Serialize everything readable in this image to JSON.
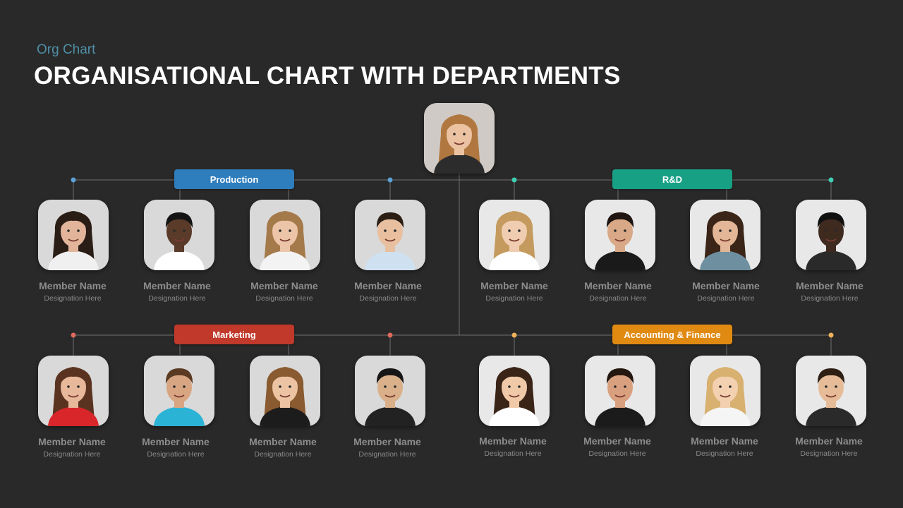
{
  "header": {
    "subtitle": "Org Chart",
    "title": "ORGANISATIONAL CHART WITH DEPARTMENTS"
  },
  "colors": {
    "background": "#292929",
    "line": "#6e6e6e",
    "production": "#2e7dbd",
    "rd": "#18a085",
    "marketing": "#c0392b",
    "accounting": "#e08a12"
  },
  "ceo": {
    "avatar": "avatar-woman-long-hair"
  },
  "departments": [
    {
      "label": "Production",
      "color": "#2e7dbd",
      "dot_color": "#5aa2d8",
      "members": [
        {
          "name": "Member Name",
          "designation": "Designation Here",
          "skin": "#e2b59a",
          "hair": "#2a1d16",
          "shirt": "#f0f0f0",
          "longhair": true
        },
        {
          "name": "Member Name",
          "designation": "Designation Here",
          "skin": "#5a3a28",
          "hair": "#141414",
          "shirt": "#ffffff",
          "longhair": false
        },
        {
          "name": "Member Name",
          "designation": "Designation Here",
          "skin": "#ecc5a8",
          "hair": "#a57a4b",
          "shirt": "#f3f3f3",
          "longhair": true
        },
        {
          "name": "Member Name",
          "designation": "Designation Here",
          "skin": "#e8c0a0",
          "hair": "#2b1e15",
          "shirt": "#cfe0f0",
          "longhair": false
        }
      ]
    },
    {
      "label": "R&D",
      "color": "#18a085",
      "dot_color": "#3fcfb3",
      "members": [
        {
          "name": "Member Name",
          "designation": "Designation Here",
          "skin": "#f0cdb0",
          "hair": "#c49a5e",
          "shirt": "#ffffff",
          "longhair": true
        },
        {
          "name": "Member Name",
          "designation": "Designation Here",
          "skin": "#d9a886",
          "hair": "#1f1612",
          "shirt": "#1a1a1a",
          "longhair": false
        },
        {
          "name": "Member Name",
          "designation": "Designation Here",
          "skin": "#e2b696",
          "hair": "#3a2518",
          "shirt": "#6d8fa0",
          "longhair": true
        },
        {
          "name": "Member Name",
          "designation": "Designation Here",
          "skin": "#3e2a1f",
          "hair": "#101010",
          "shirt": "#2a2a2a",
          "longhair": false
        }
      ]
    },
    {
      "label": "Marketing",
      "color": "#c0392b",
      "dot_color": "#e06a5c",
      "members": [
        {
          "name": "Member Name",
          "designation": "Designation Here",
          "skin": "#e8b89a",
          "hair": "#5a3320",
          "shirt": "#d8262a",
          "longhair": true
        },
        {
          "name": "Member Name",
          "designation": "Designation Here",
          "skin": "#d8a582",
          "hair": "#5a3a22",
          "shirt": "#2bb3d6",
          "longhair": false
        },
        {
          "name": "Member Name",
          "designation": "Designation Here",
          "skin": "#ecc4a4",
          "hair": "#8a5a30",
          "shirt": "#1c1c1c",
          "longhair": true
        },
        {
          "name": "Member Name",
          "designation": "Designation Here",
          "skin": "#d9b08a",
          "hair": "#161616",
          "shirt": "#222222",
          "longhair": false
        }
      ]
    },
    {
      "label": "Accounting & Finance",
      "color": "#e08a12",
      "dot_color": "#f0b25a",
      "members": [
        {
          "name": "Member Name",
          "designation": "Designation Here",
          "skin": "#f0caa8",
          "hair": "#3a2418",
          "shirt": "#ffffff",
          "longhair": true
        },
        {
          "name": "Member Name",
          "designation": "Designation Here",
          "skin": "#d8a07e",
          "hair": "#24170f",
          "shirt": "#1b1b1b",
          "longhair": false
        },
        {
          "name": "Member Name",
          "designation": "Designation Here",
          "skin": "#f2d0b0",
          "hair": "#d8b070",
          "shirt": "#f5f5f5",
          "longhair": true
        },
        {
          "name": "Member Name",
          "designation": "Designation Here",
          "skin": "#e6bc98",
          "hair": "#2e1f15",
          "shirt": "#2a2a2a",
          "longhair": false
        }
      ]
    }
  ]
}
